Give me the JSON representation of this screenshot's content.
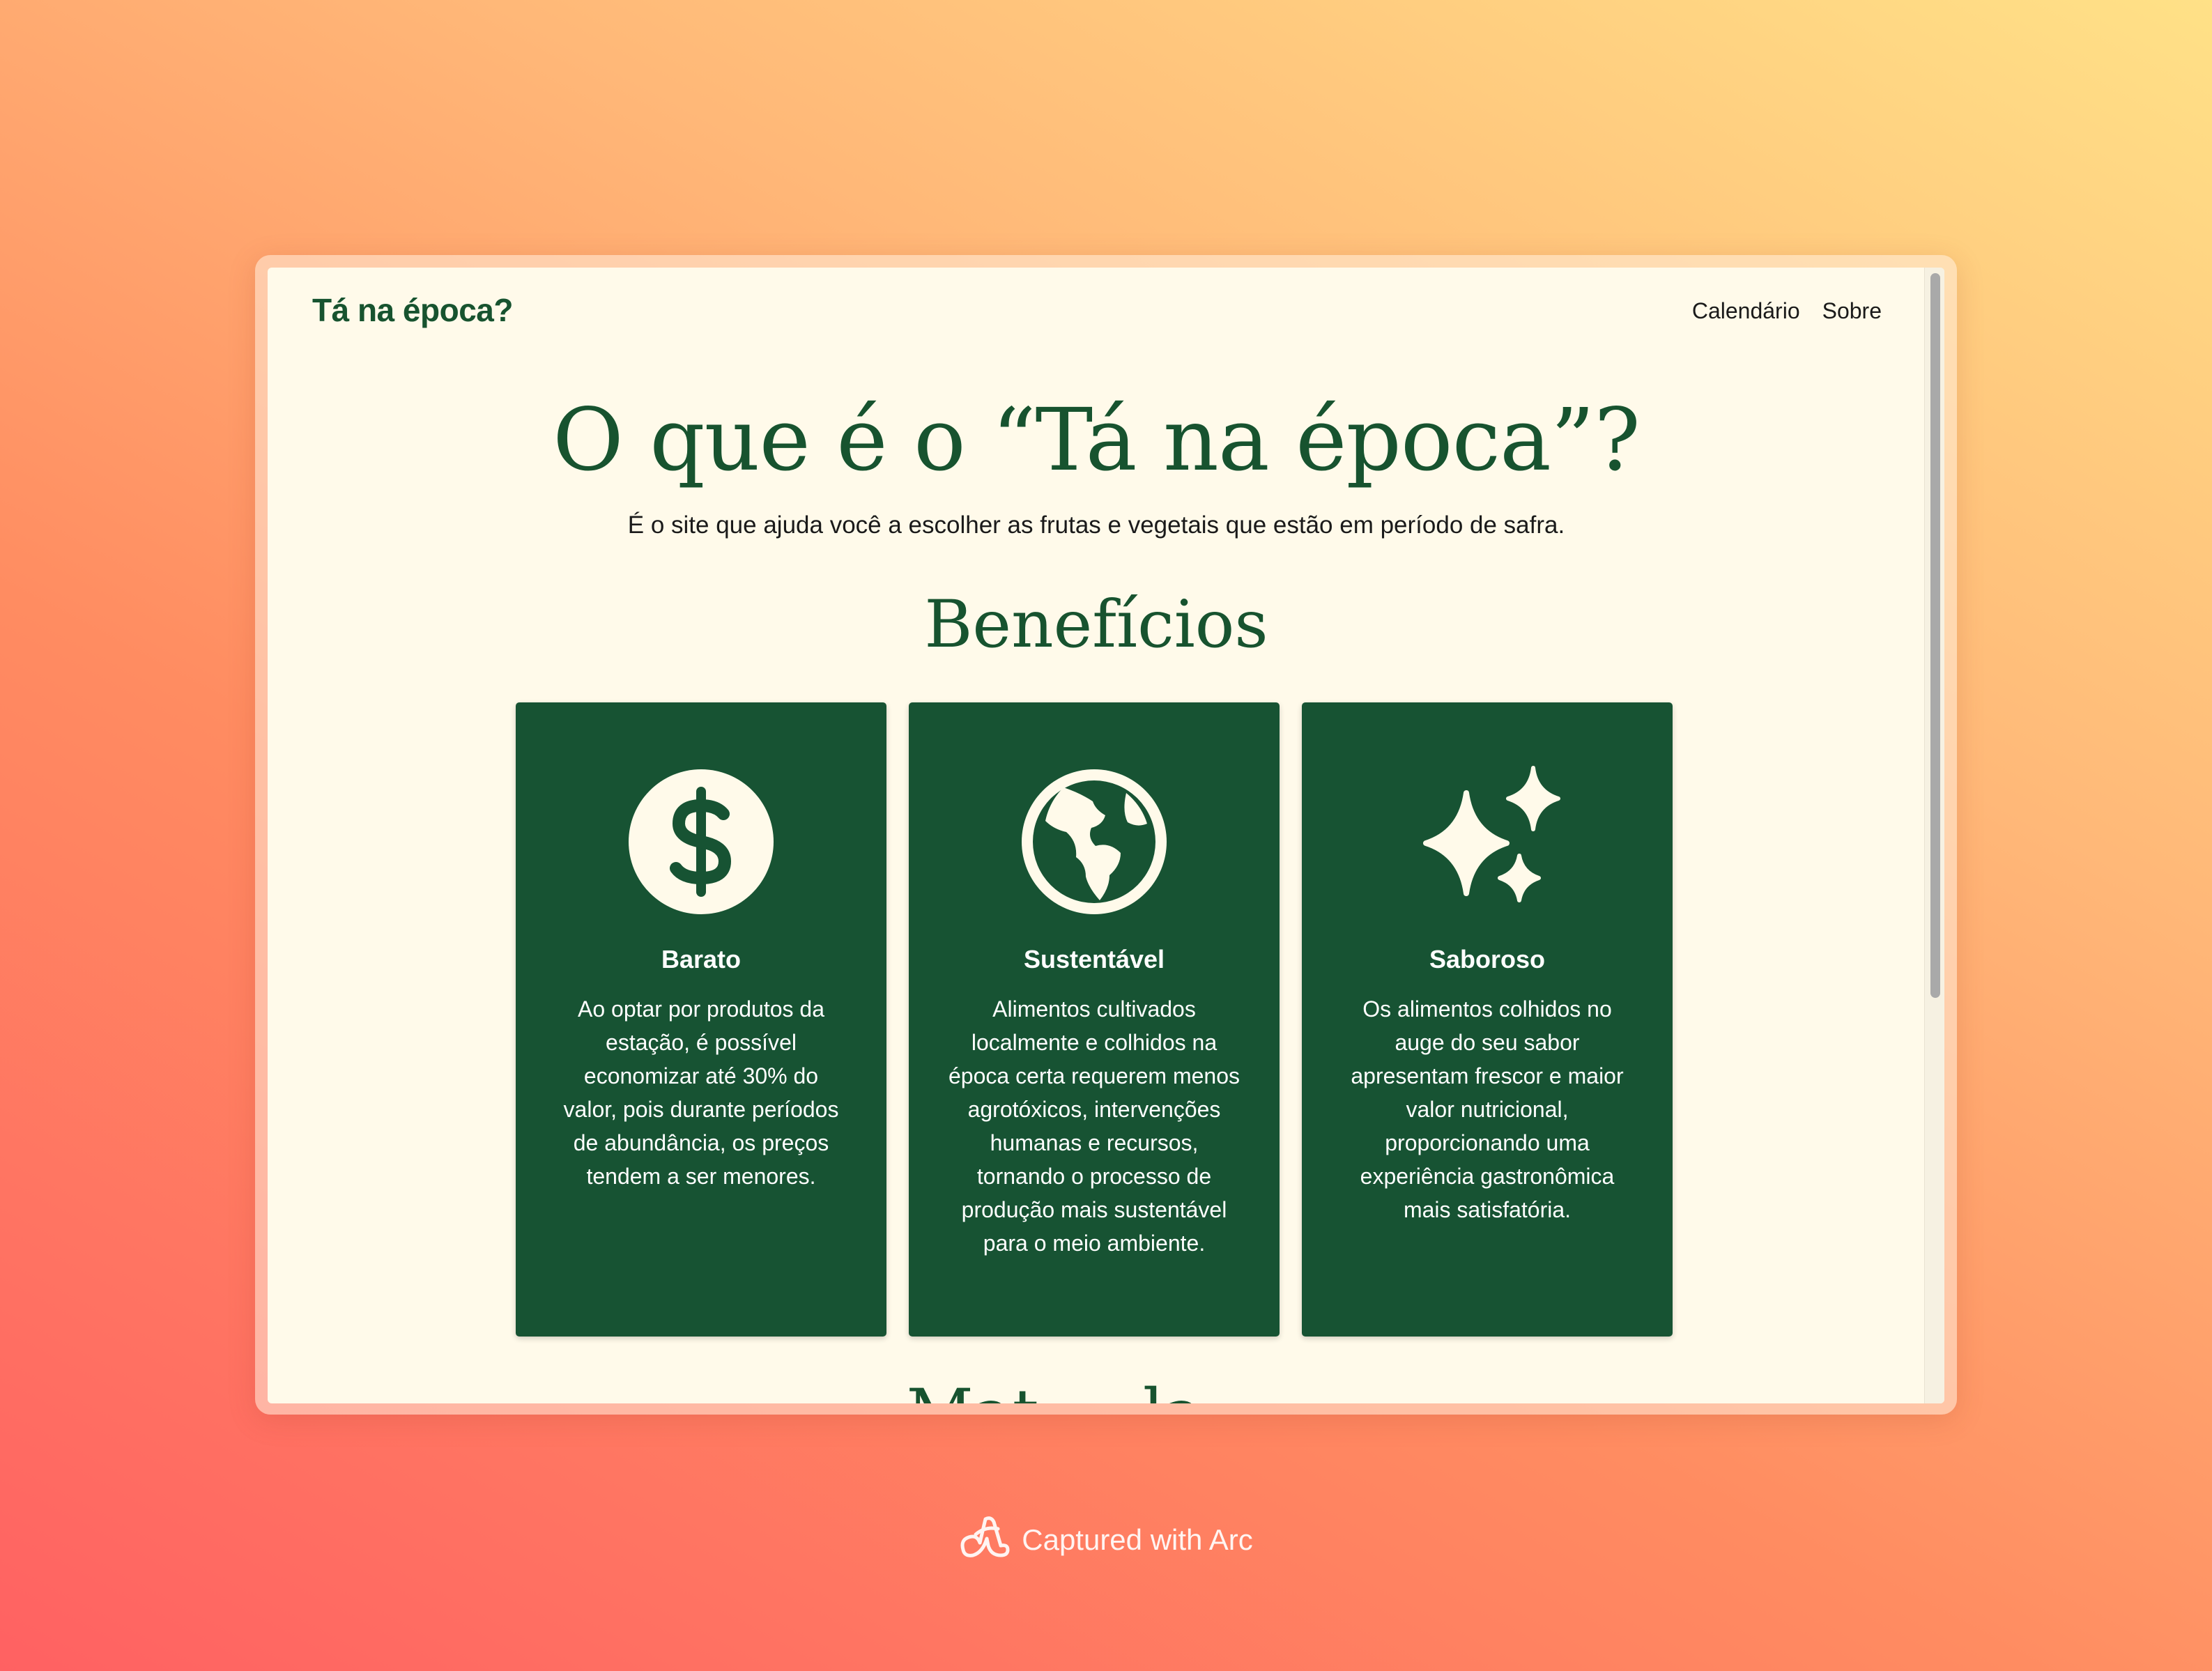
{
  "site": {
    "logo": "Tá na época?",
    "nav": [
      "Calendário",
      "Sobre"
    ]
  },
  "hero": {
    "title": "O que é o “Tá na época”?",
    "subtitle": "É o site que ajuda você a escolher as frutas e vegetais que estão em período de safra."
  },
  "benefits": {
    "title": "Benefícios",
    "cards": [
      {
        "icon": "dollar-icon",
        "title": "Barato",
        "text": "Ao optar por produtos da estação, é possível economizar até 30% do valor, pois durante períodos de abundância, os preços tendem a ser menores."
      },
      {
        "icon": "globe-icon",
        "title": "Sustentável",
        "text": "Alimentos cultivados localmente e colhidos na época certa requerem menos agrotóxicos, intervenções humanas e recursos, tornando o processo de produção mais sustentável para o meio ambiente."
      },
      {
        "icon": "sparkles-icon",
        "title": "Saboroso",
        "text": "Os alimentos colhidos no auge do seu sabor apresentam frescor e maior valor nutricional, proporcionando uma experiência gastronômica mais satisfatória."
      }
    ]
  },
  "next_section": {
    "title_partial": "Mat ... la ..."
  },
  "colors": {
    "brand_green": "#17532f",
    "card_green": "#175333",
    "page_background": "#fffaea"
  },
  "badge": {
    "icon": "arc-logo-icon",
    "text": "Captured with Arc"
  }
}
